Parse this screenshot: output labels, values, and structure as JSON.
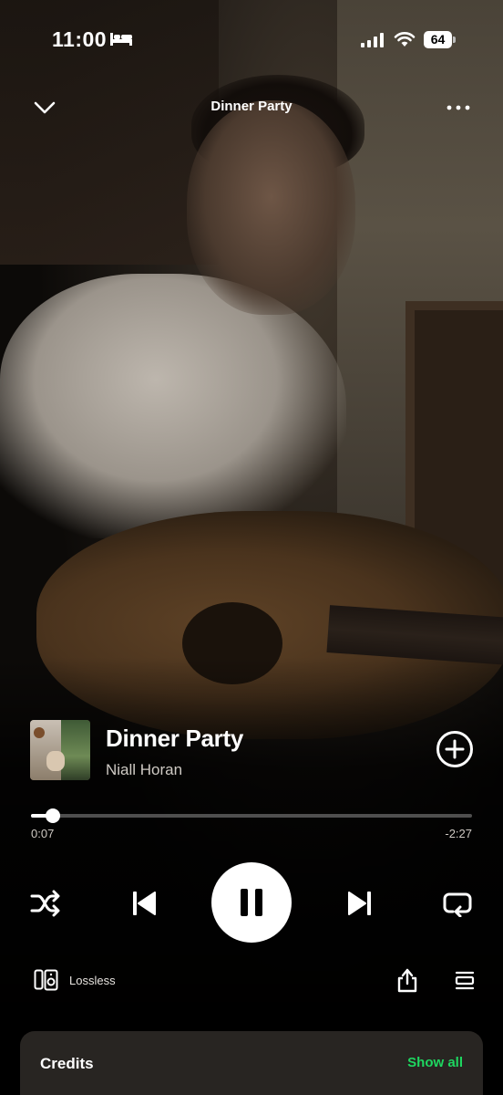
{
  "status_bar": {
    "time": "11:00",
    "battery": "64"
  },
  "header": {
    "title": "Dinner Party"
  },
  "track": {
    "title": "Dinner Party",
    "artist": "Niall Horan"
  },
  "progress": {
    "elapsed": "0:07",
    "remaining": "-2:27",
    "fraction": 0.05
  },
  "playback": {
    "state": "playing"
  },
  "device": {
    "label": "Lossless"
  },
  "credits": {
    "title": "Credits",
    "show_all": "Show all"
  },
  "colors": {
    "accent": "#1ed760",
    "card": "#282522"
  }
}
